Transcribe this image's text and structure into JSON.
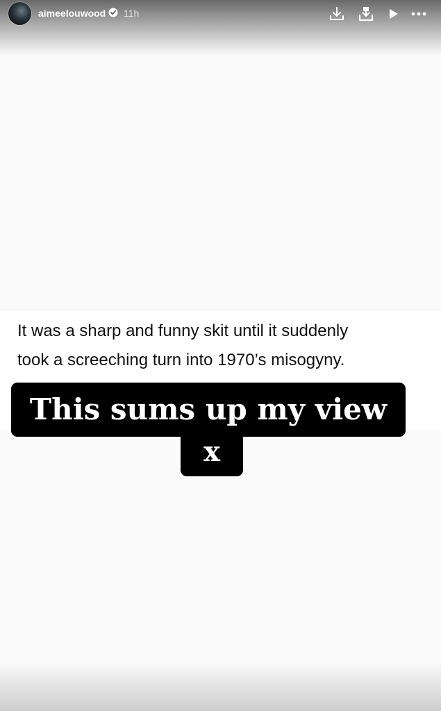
{
  "header": {
    "username": "aimeelouwood",
    "timestamp": "11h",
    "icons": [
      "avatar",
      "verified-badge-icon",
      "download-icon",
      "save-icon",
      "play-icon",
      "more-icon"
    ]
  },
  "tweet": {
    "lines": [
      "It was a sharp and funny skit until it suddenly",
      "took a screeching turn into 1970’s misogyny."
    ]
  },
  "caption": {
    "line1": "This sums up my view",
    "line2": "x"
  },
  "colors": {
    "background": "#fafafa",
    "caption_bg": "#000000",
    "caption_text": "#ffffff",
    "header_text": "#ffffff"
  }
}
